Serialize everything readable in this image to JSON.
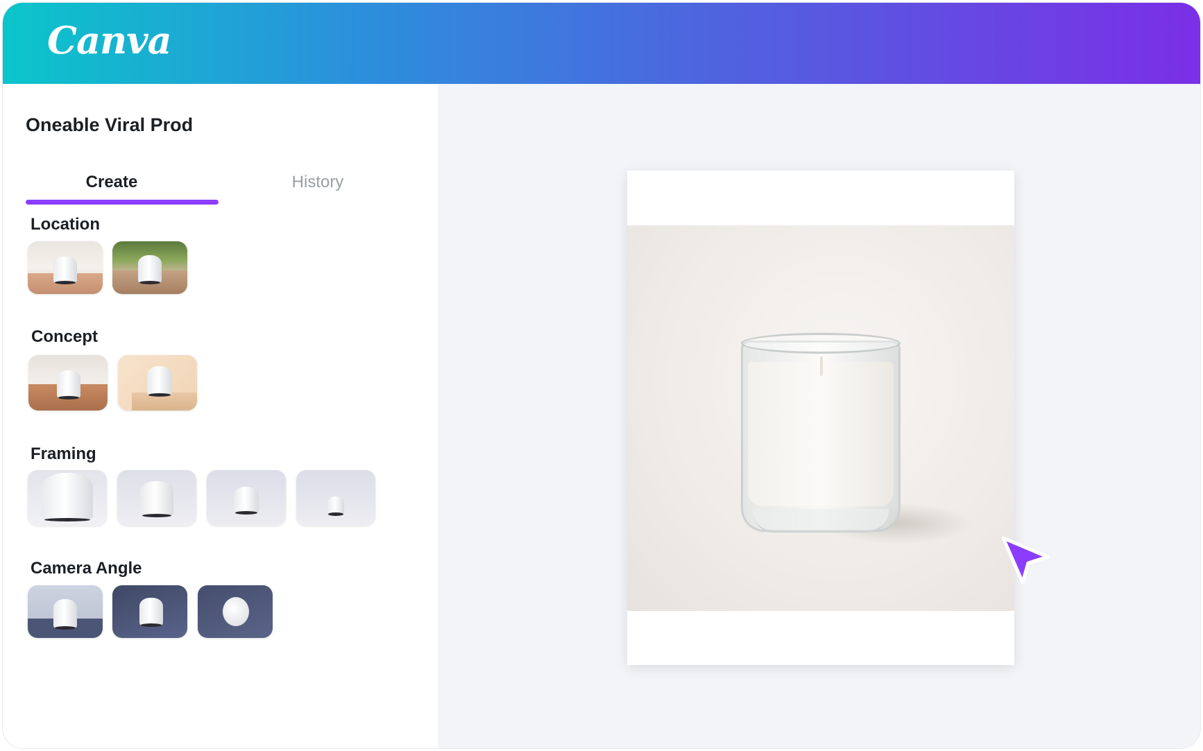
{
  "header": {
    "logo_text": "Canva"
  },
  "project": {
    "title": "Oneable Viral Prod"
  },
  "tabs": [
    {
      "label": "Create",
      "active": true
    },
    {
      "label": "History",
      "active": false
    }
  ],
  "sections": {
    "location": {
      "title": "Location",
      "options": [
        "location-indoor-table",
        "location-outdoor-patio"
      ]
    },
    "concept": {
      "title": "Concept",
      "options": [
        "concept-wood-shelf",
        "concept-peach-pedestal"
      ]
    },
    "framing": {
      "title": "Framing",
      "options": [
        "framing-extreme-close",
        "framing-close",
        "framing-medium",
        "framing-wide"
      ]
    },
    "camera_angle": {
      "title": "Camera Angle",
      "options": [
        "angle-eye-level",
        "angle-high",
        "angle-top-down"
      ]
    }
  },
  "colors": {
    "accent": "#8b3dff",
    "header_gradient_start": "#0bc5ca",
    "header_gradient_end": "#7b2fe6",
    "canvas_background": "#f2f4f7"
  },
  "icons": {
    "cursor": "pointer-arrow-icon"
  }
}
